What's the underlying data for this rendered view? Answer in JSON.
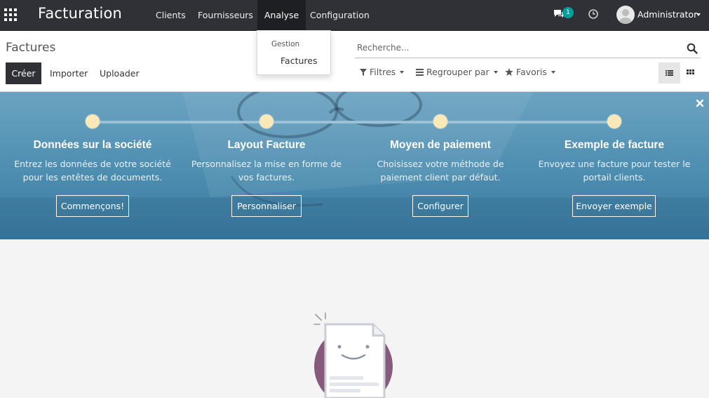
{
  "navbar": {
    "brand": "Facturation",
    "menu": [
      {
        "label": "Clients"
      },
      {
        "label": "Fournisseurs"
      },
      {
        "label": "Analyse"
      },
      {
        "label": "Configuration"
      }
    ],
    "notification_count": "1",
    "user": "Administrator"
  },
  "dropdown": {
    "header": "Gestion",
    "item": "Factures"
  },
  "control_panel": {
    "breadcrumb": "Factures",
    "create_label": "Créer",
    "import_label": "Importer",
    "upload_label": "Uploader",
    "search_placeholder": "Recherche...",
    "filters_label": "Filtres",
    "groupby_label": "Regrouper par",
    "favorites_label": "Favoris"
  },
  "onboarding": {
    "steps": [
      {
        "title": "Données sur la société",
        "desc_line1": "Entrez les données de votre société",
        "desc_line2": "pour les entêtes de documents.",
        "button": "Commençons!"
      },
      {
        "title": "Layout Facture",
        "desc_line1": "Personnalisez la mise en forme de",
        "desc_line2": "vos factures.",
        "button": "Personnaliser"
      },
      {
        "title": "Moyen de paiement",
        "desc_line1": "Choisissez votre méthode de",
        "desc_line2": "paiement client par défaut.",
        "button": "Configurer"
      },
      {
        "title": "Exemple de facture",
        "desc_line1": "Envoyez une facture pour tester le",
        "desc_line2": "portail clients.",
        "button": "Envoyer exemple"
      }
    ]
  },
  "colors": {
    "navbar_bg": "#2f3136",
    "step_dot": "#fbe8b9",
    "badge": "#00a09d",
    "illustration_circle": "#875a7b"
  }
}
